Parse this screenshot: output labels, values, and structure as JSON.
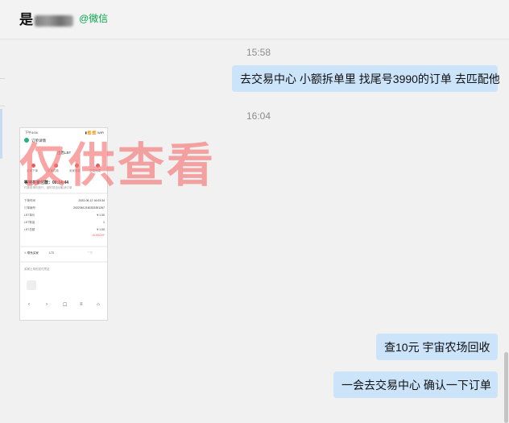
{
  "header": {
    "chat_name": "是",
    "chat_source": "@微信"
  },
  "messages": [
    {
      "type": "time",
      "text": "15:58"
    },
    {
      "type": "outgoing",
      "text": "去交易中心 小额拆单里  找尾号3990的订单  去匹配他"
    },
    {
      "type": "time",
      "text": "16:04"
    },
    {
      "type": "image_incoming",
      "screenshot": {
        "status_time": "下午4:04",
        "status_icons": "▮ 📶 📶 WiFi",
        "title": "订单详情",
        "currency": "出售LBT",
        "steps": [
          "买家下单",
          "买家付款",
          "卖家收款",
          "交易完成"
        ],
        "wait_text": "等待买家付款：00:14:44",
        "warn_text": "付款前请勿放行，超时将自动取消订单",
        "rows": [
          {
            "label": "下单时间",
            "value": "2022-06-12 16:03:34"
          },
          {
            "label": "订单编号",
            "value": "20220612160333351267"
          },
          {
            "label": "LBT单价",
            "value": "¥ 1.00"
          },
          {
            "label": "LBT数量",
            "value": "1"
          },
          {
            "label": "LBT总额",
            "value": "¥ 1.00"
          },
          {
            "label": "",
            "value": "≈8.00CNY"
          }
        ],
        "contact": "联系买家",
        "phone_partial": "173",
        "report": "举报",
        "upload_hint": "买家上传的支付凭证",
        "nav_icons": [
          "‹",
          "›",
          "☐",
          "≡",
          "⌂"
        ]
      },
      "watermark": "仅供查看"
    },
    {
      "type": "outgoing",
      "text": "查10元   宇宙农场回收"
    },
    {
      "type": "outgoing",
      "text": "一会去交易中心 确认一下订单"
    }
  ],
  "colors": {
    "outgoing_bubble": "#cce4fa",
    "background": "#f1f1f1",
    "source_green": "#07a64a",
    "watermark": "#f47676"
  },
  "icons": [
    "back-arrow-icon",
    "phone-icon",
    "image-placeholder-icon"
  ]
}
